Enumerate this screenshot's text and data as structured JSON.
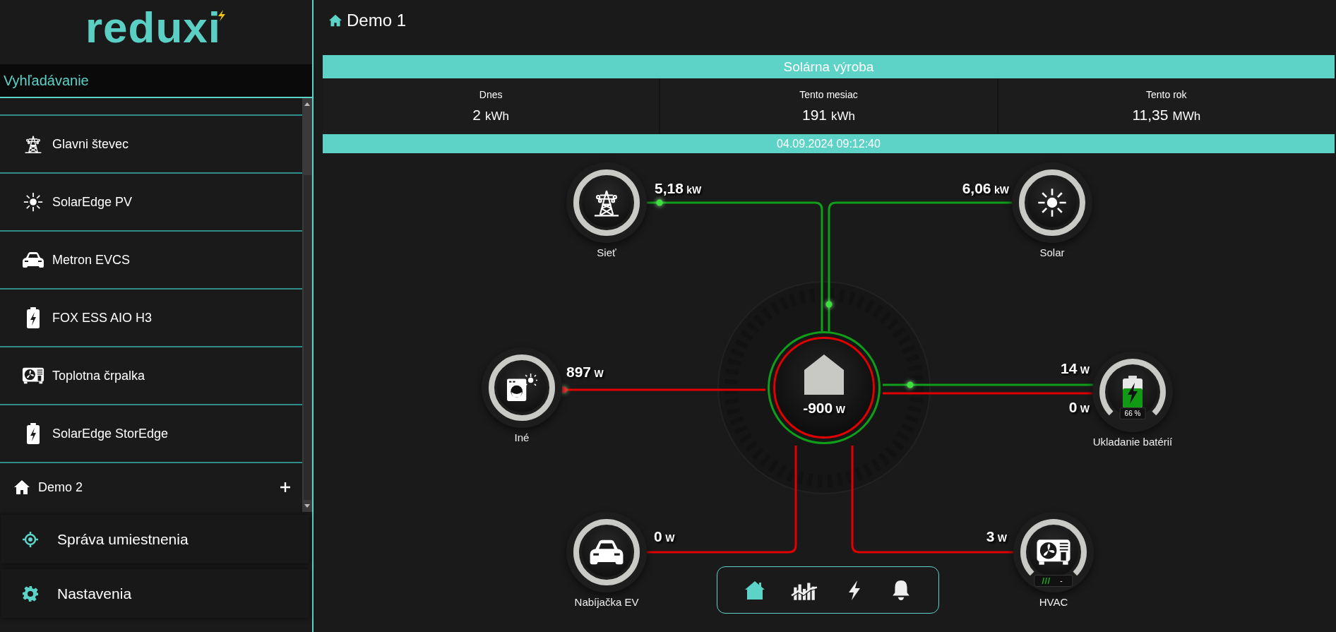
{
  "sidebar": {
    "logo": "reduxi",
    "search": {
      "placeholder": "Vyhľadávanie"
    },
    "devices": [
      {
        "kind": "tower",
        "label": "Glavni števec"
      },
      {
        "kind": "sun",
        "label": "SolarEdge PV"
      },
      {
        "kind": "car",
        "label": "Metron EVCS"
      },
      {
        "kind": "battery",
        "label": "FOX ESS AIO H3"
      },
      {
        "kind": "heatpump",
        "label": "Toplotna črpalka"
      },
      {
        "kind": "battery",
        "label": "SolarEdge StorEdge"
      }
    ],
    "site": {
      "label": "Demo 2"
    },
    "menu": [
      {
        "kind": "location",
        "label": "Správa umiestnenia"
      },
      {
        "kind": "settings",
        "label": "Nastavenia"
      }
    ]
  },
  "page": {
    "title": "Demo 1",
    "production": {
      "title": "Solárna výroba",
      "stats": [
        {
          "label": "Dnes",
          "value": "2",
          "unit": "kWh"
        },
        {
          "label": "Tento mesiac",
          "value": "191",
          "unit": "kWh"
        },
        {
          "label": "Tento rok",
          "value": "11,35",
          "unit": "MWh"
        }
      ],
      "timestamp": "04.09.2024 09:12:40"
    },
    "flow": {
      "center": {
        "value": "-900",
        "unit": "W"
      },
      "nodes": [
        {
          "kind": "grid",
          "label": "Sieť",
          "flows": [
            {
              "value": "5,18",
              "unit": "kW",
              "color": "#0f9d1a"
            }
          ]
        },
        {
          "kind": "solar",
          "label": "Solar",
          "flows": [
            {
              "value": "6,06",
              "unit": "kW",
              "color": "#0f9d1a"
            }
          ]
        },
        {
          "kind": "other",
          "label": "Iné",
          "flows": [
            {
              "value": "897",
              "unit": "W",
              "color": "#e00000"
            }
          ]
        },
        {
          "kind": "battery",
          "label": "Ukladanie batérií",
          "level": 0.66,
          "badge": "66 %",
          "flows": [
            {
              "value": "14",
              "unit": "W",
              "color": "#0f9d1a"
            },
            {
              "value": "0",
              "unit": "W",
              "color": "#e00000"
            }
          ]
        },
        {
          "kind": "ev",
          "label": "Nabíjačka EV",
          "flows": [
            {
              "value": "0",
              "unit": "W",
              "color": "#e00000"
            }
          ]
        },
        {
          "kind": "hvac",
          "label": "HVAC",
          "badge": "-",
          "flows": [
            {
              "value": "3",
              "unit": "W",
              "color": "#e00000"
            }
          ]
        }
      ],
      "nav": [
        {
          "kind": "home",
          "selected": true
        },
        {
          "kind": "chart",
          "selected": false
        },
        {
          "kind": "bolt",
          "selected": false
        },
        {
          "kind": "bell",
          "selected": false
        }
      ]
    }
  }
}
